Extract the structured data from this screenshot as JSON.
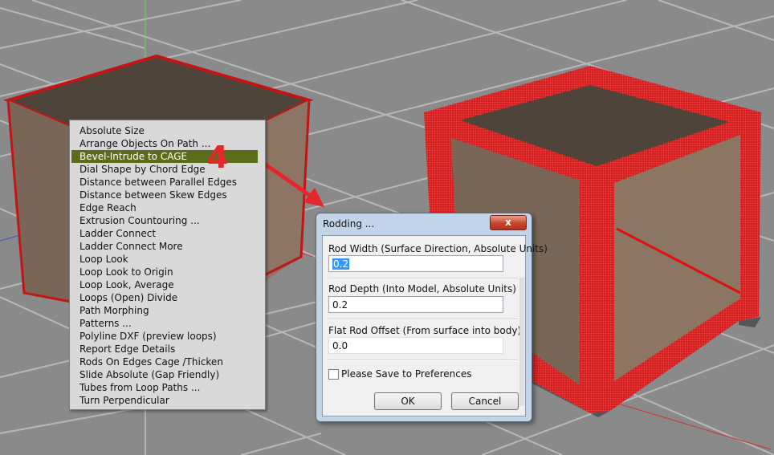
{
  "step_label": "4",
  "context_menu": {
    "items": [
      "Absolute Size",
      "Arrange Objects On Path ...",
      "Bevel-Intrude to CAGE",
      "Dial Shape by Chord Edge",
      "Distance between Parallel Edges",
      "Distance between Skew Edges",
      "Edge Reach",
      "Extrusion Countouring ...",
      "Ladder Connect",
      "Ladder Connect More",
      "Loop Look",
      "Loop Look to Origin",
      "Loop Look, Average",
      "Loops (Open) Divide",
      "Path Morphing",
      "Patterns ...",
      "Polyline DXF (preview loops)",
      "Report Edge Details",
      "Rods On Edges Cage /Thicken",
      "Slide Absolute (Gap Friendly)",
      "Tubes from Loop Paths ...",
      "Turn Perpendicular"
    ],
    "selected_index": 2
  },
  "dialog": {
    "title": "Rodding ...",
    "close_label": "x",
    "rod_width_label": "Rod Width (Surface Direction, Absolute Units)",
    "rod_width_value": "0.2",
    "rod_depth_label": "Rod Depth (Into Model, Absolute Units)",
    "rod_depth_value": "0.2",
    "offset_label": "Flat Rod Offset (From surface into body)",
    "offset_value": "0.0",
    "save_pref_label": "Please Save to Preferences",
    "ok_label": "OK",
    "cancel_label": "Cancel"
  },
  "colors": {
    "viewport_bg": "#8a8a8a",
    "menu_highlight": "#5b6d1a",
    "annotation_red": "#e8252a",
    "cage_red": "#d42020"
  }
}
